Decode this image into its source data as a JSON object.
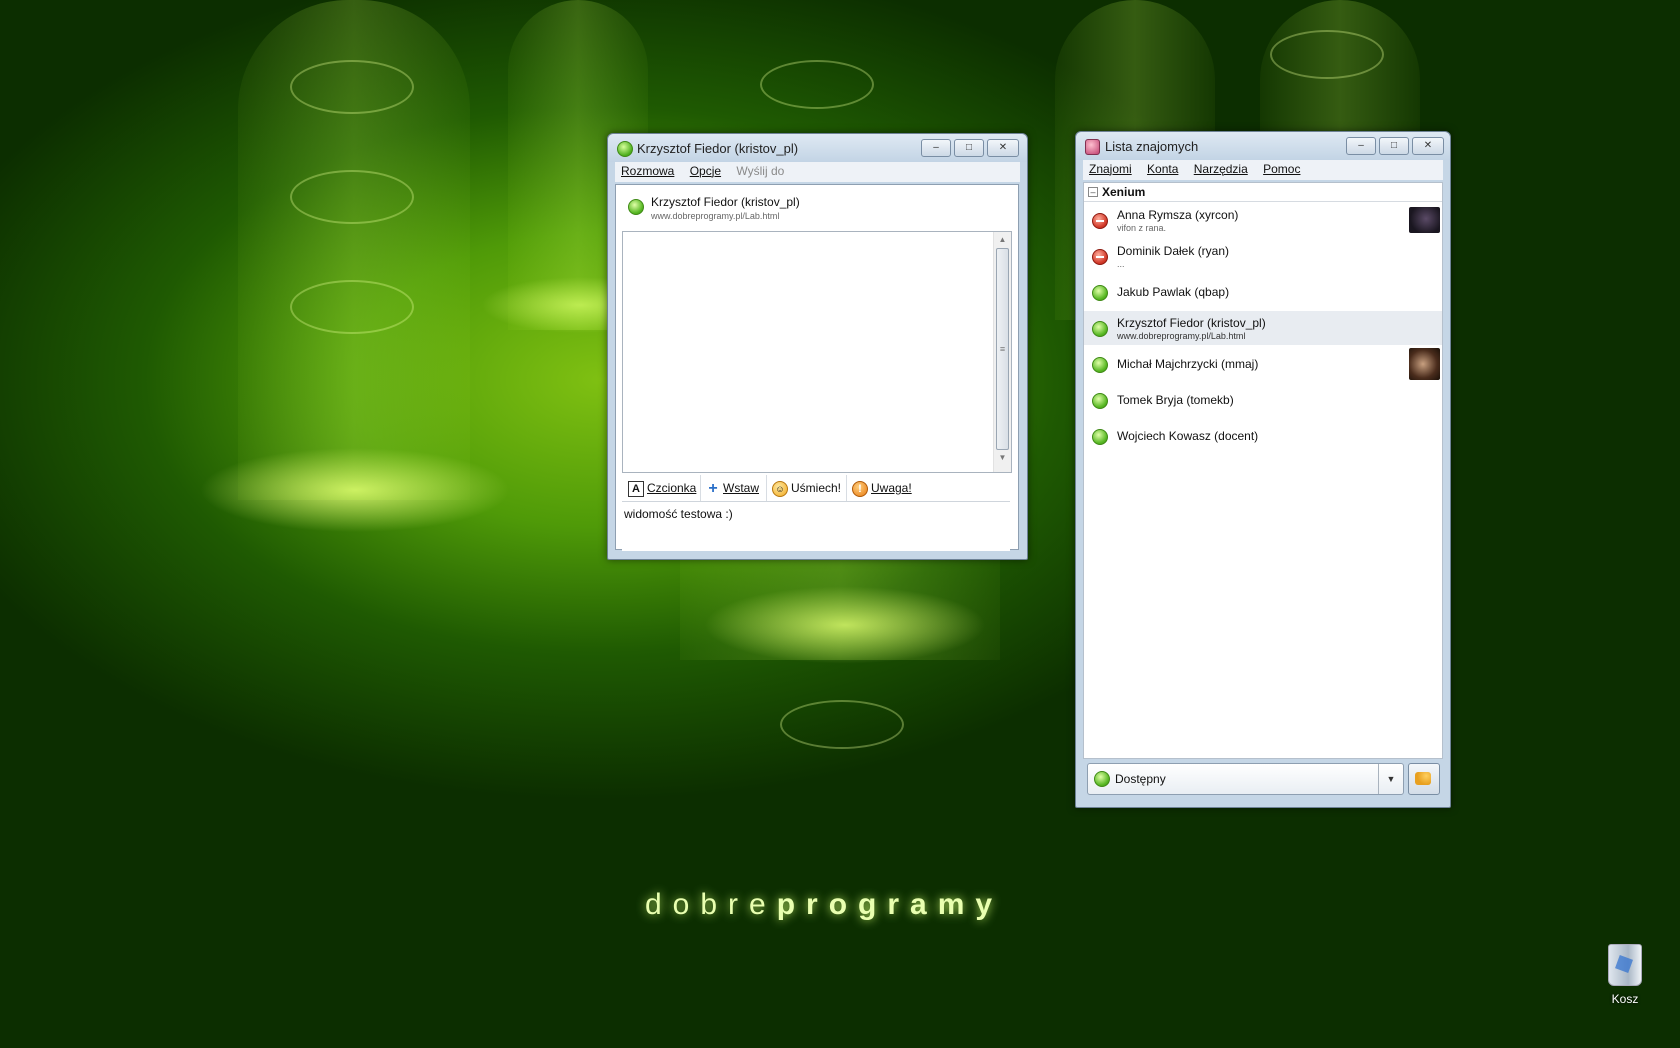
{
  "desktop": {
    "wallpaper_text_light": "dobre",
    "wallpaper_text_bold": "programy",
    "recycle_bin_label": "Kosz"
  },
  "chat_window": {
    "title": "Krzysztof Fiedor (kristov_pl)",
    "menu": [
      {
        "label": "Rozmowa",
        "enabled": true
      },
      {
        "label": "Opcje",
        "enabled": true
      },
      {
        "label": "Wyślij do",
        "enabled": false
      }
    ],
    "contact_name": "Krzysztof Fiedor (kristov_pl)",
    "contact_desc": "www.dobreprogramy.pl/Lab.html",
    "toolbar": {
      "font": "Czcionka",
      "insert": "Wstaw",
      "smile": "Uśmiech!",
      "warning": "Uwaga!"
    },
    "input_text": "widomość testowa :)"
  },
  "contacts_window": {
    "title": "Lista znajomych",
    "menu": [
      {
        "label": "Znajomi"
      },
      {
        "label": "Konta"
      },
      {
        "label": "Narzędzia"
      },
      {
        "label": "Pomoc"
      }
    ],
    "group_name": "Xenium",
    "contacts": [
      {
        "name": "Anna Rymsza (xyrcon)",
        "desc": "vifon z rana.",
        "status": "dnd",
        "avatar": true
      },
      {
        "name": "Dominik Dałek (ryan)",
        "desc": "...",
        "status": "dnd",
        "avatar": false
      },
      {
        "name": "Jakub Pawlak (qbap)",
        "desc": "",
        "status": "online",
        "avatar": false
      },
      {
        "name": "Krzysztof Fiedor (kristov_pl)",
        "desc": "www.dobreprogramy.pl/Lab.html",
        "status": "online",
        "avatar": false,
        "selected": true
      },
      {
        "name": "Michał Majchrzycki (mmaj)",
        "desc": "",
        "status": "online",
        "avatar": true
      },
      {
        "name": "Tomek Bryja (tomekb)",
        "desc": "",
        "status": "online",
        "avatar": false
      },
      {
        "name": "Wojciech Kowasz (docent)",
        "desc": "",
        "status": "online",
        "avatar": false
      }
    ],
    "status_selected": "Dostępny"
  },
  "colors": {
    "online": "#58b824",
    "dnd": "#d23a2a",
    "selected_row": "#e8ecf1"
  }
}
